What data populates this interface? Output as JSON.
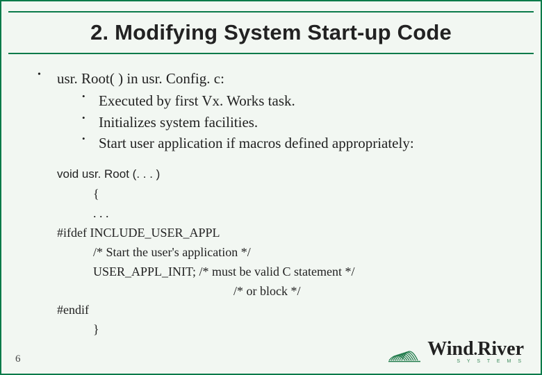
{
  "slide": {
    "title": "2. Modifying System Start-up Code",
    "page_number": "6"
  },
  "bullets": {
    "main": "usr. Root( ) in usr. Config. c:",
    "sub": [
      "Executed by first Vx. Works task.",
      "Initializes system facilities.",
      "Start user application if macros defined appropriately:"
    ]
  },
  "code": {
    "header": "void usr. Root (. . . )",
    "lines": [
      {
        "pad": "pad1",
        "text": "{"
      },
      {
        "pad": "pad1",
        "text": ". . ."
      },
      {
        "pad": "",
        "text": "#ifdef INCLUDE_USER_APPL"
      },
      {
        "pad": "pad2",
        "text": "/* Start the user's application */"
      },
      {
        "pad": "pad2",
        "text": "USER_APPL_INIT; /* must be valid C statement */"
      },
      {
        "pad": "comment2",
        "text": "/* or block */"
      },
      {
        "pad": "",
        "text": "#endif"
      },
      {
        "pad": "pad1",
        "text": "}"
      }
    ]
  },
  "logo": {
    "company": "Wind",
    "dot": ".",
    "company2": "River",
    "tagline": "S Y S T E M S",
    "color": "#1f7a4a"
  }
}
